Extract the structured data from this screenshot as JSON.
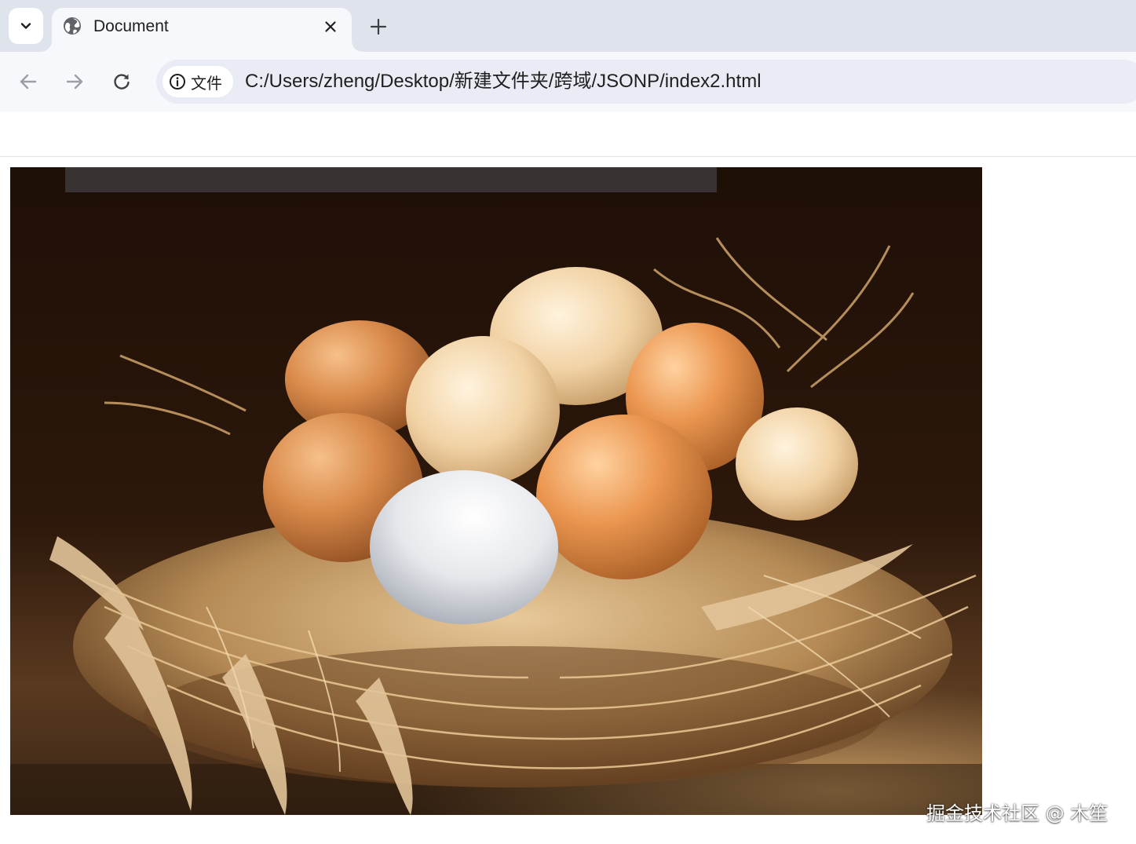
{
  "tabs": [
    {
      "title": "Document",
      "icon": "globe-icon",
      "active": true
    }
  ],
  "toolbar": {
    "back_icon": "arrow-left-icon",
    "forward_icon": "arrow-right-icon",
    "reload_icon": "reload-icon",
    "security_chip_label": "文件",
    "url": "C:/Users/zheng/Desktop/新建文件夹/跨域/JSONP/index2.html"
  },
  "page": {
    "image_subject": "brown and white eggs in a straw nest"
  },
  "watermark": "掘金技术社区 @ 木笙",
  "colors": {
    "tabstrip": "#dfe3eb",
    "toolbar": "#f7f8fc",
    "omnibox": "#e9ecf4"
  }
}
